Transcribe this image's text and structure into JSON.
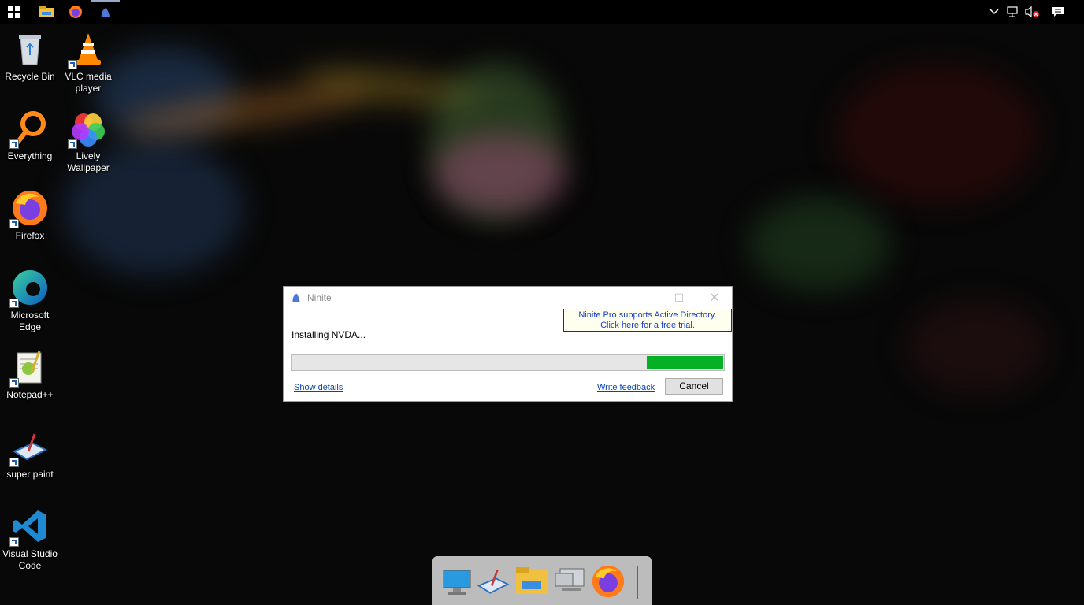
{
  "taskbar": {
    "icons": [
      "windows-start-icon",
      "file-explorer-icon",
      "firefox-icon",
      "ninite-icon"
    ],
    "tray": [
      "chevron-up-icon",
      "network-icon",
      "volume-muted-icon",
      "notifications-icon"
    ]
  },
  "desktop": {
    "icons": [
      {
        "label": "Recycle Bin",
        "icon": "recycle-bin-icon"
      },
      {
        "label": "VLC media player",
        "icon": "vlc-icon"
      },
      {
        "label": "Everything",
        "icon": "everything-search-icon"
      },
      {
        "label": "Lively Wallpaper",
        "icon": "lively-wallpaper-icon"
      },
      {
        "label": "Firefox",
        "icon": "firefox-icon"
      },
      {
        "label": "Microsoft Edge",
        "icon": "edge-icon"
      },
      {
        "label": "Notepad++",
        "icon": "notepadpp-icon"
      },
      {
        "label": "super paint",
        "icon": "super-paint-icon"
      },
      {
        "label": "Visual Studio Code",
        "icon": "vscode-icon"
      }
    ]
  },
  "dialog": {
    "title": "Ninite",
    "promo_line1": "Ninite Pro supports Active Directory.",
    "promo_line2": "Click here for a free trial.",
    "status": "Installing NVDA...",
    "progress": {
      "left_fraction": 0.823,
      "right_fraction": 1.0
    },
    "show_details": "Show details",
    "write_feedback": "Write feedback",
    "cancel": "Cancel"
  },
  "dock": {
    "items": [
      "this-pc-icon",
      "super-paint-icon",
      "file-explorer-icon",
      "network-computer-icon",
      "firefox-icon"
    ]
  },
  "colors": {
    "progress_fill": "#06b025",
    "link": "#0645ad",
    "promo_text": "#1a3ec8"
  }
}
